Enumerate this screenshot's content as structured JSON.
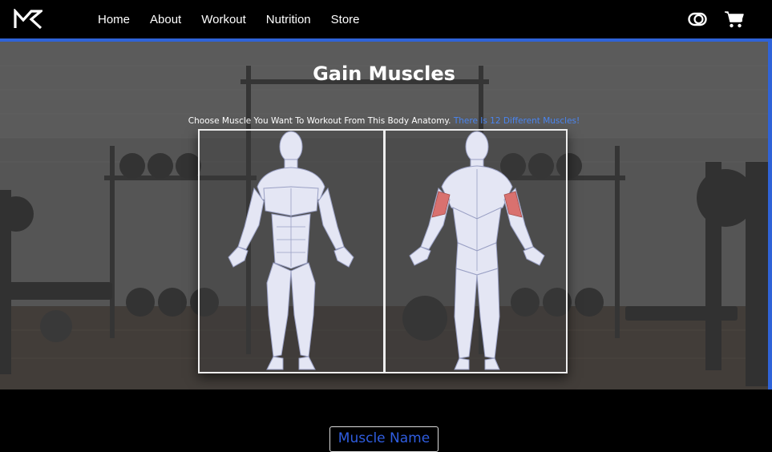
{
  "nav": {
    "logo": "logo-icon",
    "links": [
      "Home",
      "About",
      "Workout",
      "Nutrition",
      "Store"
    ],
    "theme_toggle": "toggle-icon",
    "cart": "cart-icon"
  },
  "hero": {
    "title": "Gain Muscles",
    "subtitle": "Choose Muscle You Want To Workout From This Body Anatomy.",
    "subtitle_highlight": "There Is 12 Different Muscles!",
    "highlight_color": "#4b86f0"
  },
  "anatomy": {
    "front_label": "front-body",
    "back_label": "back-body",
    "selected_color": "#d9716f",
    "body_color": "#e4e6f4"
  },
  "muscle_name": {
    "label": "Muscle Name",
    "color": "#2f5de0"
  },
  "colors": {
    "accent": "#2f63d8",
    "nav_bg": "#000000"
  }
}
